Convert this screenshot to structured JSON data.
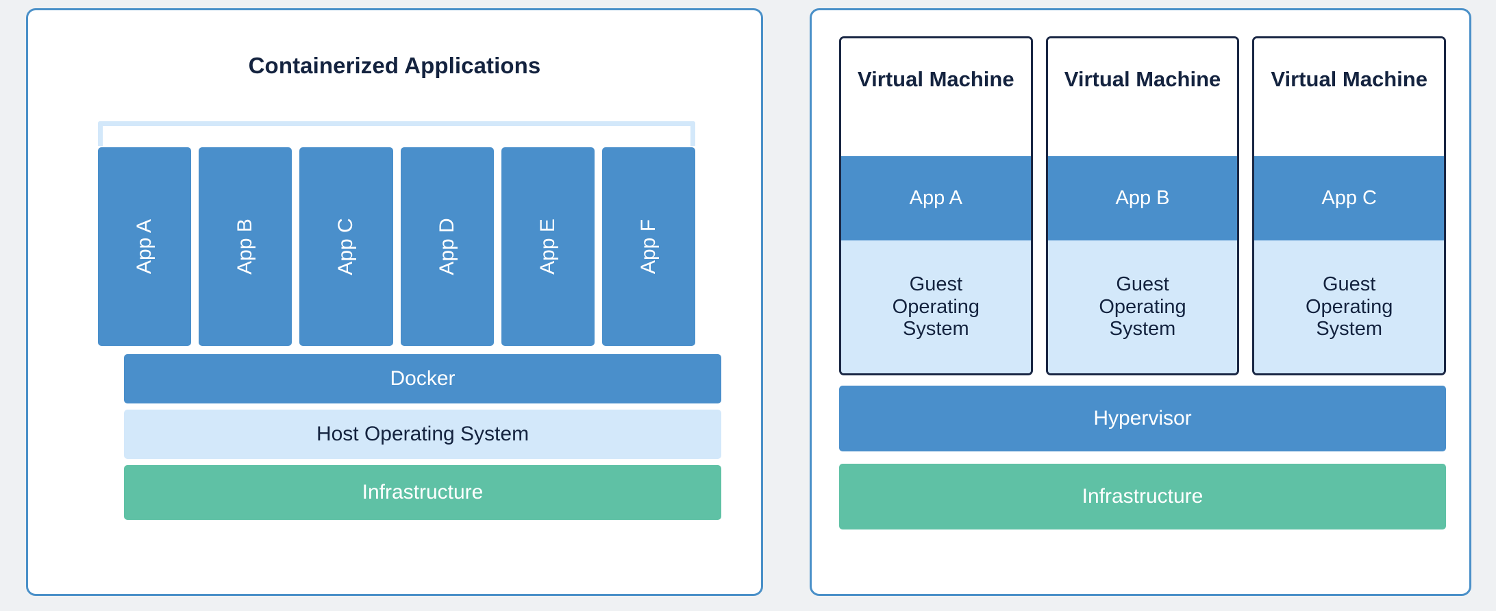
{
  "colors": {
    "background": "#eff1f3",
    "panel_border": "#4a90c8",
    "accent_blue": "#4a8fcb",
    "light_blue": "#d3e8fa",
    "green": "#5fc1a5",
    "navy": "#14233f",
    "vm_border": "#1a2744"
  },
  "containers_panel": {
    "title": "Containerized Applications",
    "apps": [
      {
        "label": "App A"
      },
      {
        "label": "App B"
      },
      {
        "label": "App C"
      },
      {
        "label": "App D"
      },
      {
        "label": "App E"
      },
      {
        "label": "App F"
      }
    ],
    "layers": [
      {
        "label": "Docker"
      },
      {
        "label": "Host Operating System"
      },
      {
        "label": "Infrastructure"
      }
    ]
  },
  "vms_panel": {
    "machines": [
      {
        "title": "Virtual Machine",
        "app": "App A",
        "guest_os": "Guest\nOperating\nSystem"
      },
      {
        "title": "Virtual Machine",
        "app": "App B",
        "guest_os": "Guest\nOperating\nSystem"
      },
      {
        "title": "Virtual Machine",
        "app": "App C",
        "guest_os": "Guest\nOperating\nSystem"
      }
    ],
    "layers": [
      {
        "label": "Hypervisor"
      },
      {
        "label": "Infrastructure"
      }
    ]
  }
}
